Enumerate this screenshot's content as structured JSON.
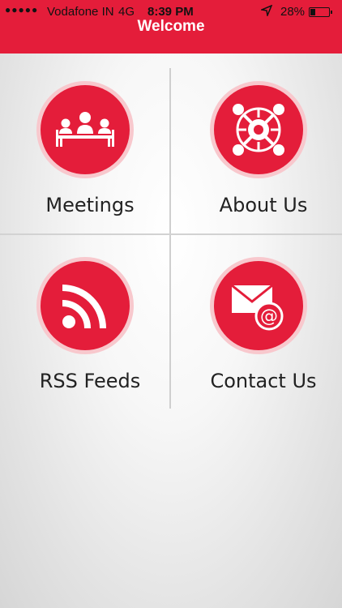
{
  "status_bar": {
    "signal": "●●●●●",
    "carrier": "Vodafone IN",
    "network": "4G",
    "time": "8:39 PM",
    "location_icon": "location-arrow-icon",
    "battery_percent_text": "28%",
    "battery_level": 0.28
  },
  "header": {
    "title": "Welcome",
    "color": "#e41d3a"
  },
  "menu": [
    {
      "label": "Meetings",
      "icon": "meeting-icon"
    },
    {
      "label": "About Us",
      "icon": "network-people-icon"
    },
    {
      "label": "RSS Feeds",
      "icon": "rss-icon"
    },
    {
      "label": "Contact Us",
      "icon": "email-icon"
    }
  ]
}
